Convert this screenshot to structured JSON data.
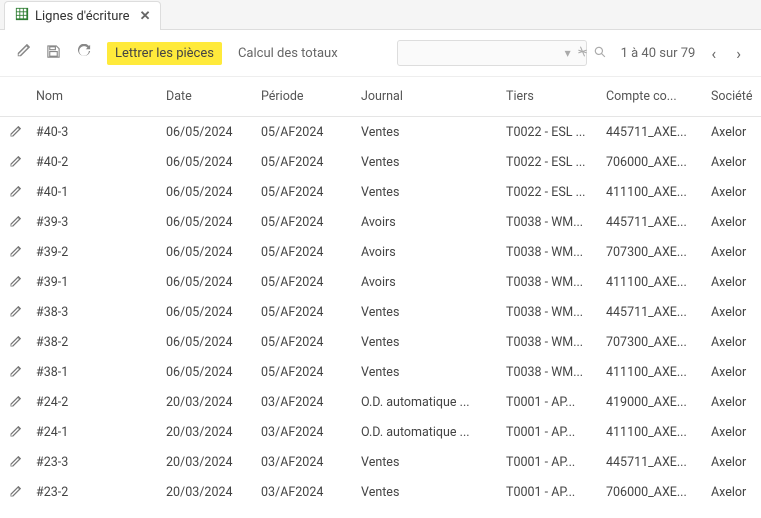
{
  "tab": {
    "title": "Lignes d'écriture"
  },
  "toolbar": {
    "lettrer": "Lettrer les pièces",
    "calcul": "Calcul des totaux"
  },
  "pager": {
    "text": "1 à 40 sur 79"
  },
  "columns": {
    "nom": "Nom",
    "date": "Date",
    "periode": "Période",
    "journal": "Journal",
    "tiers": "Tiers",
    "compte": "Compte co...",
    "societe": "Société"
  },
  "rows": [
    {
      "nom": "#40-3",
      "date": "06/05/2024",
      "periode": "05/AF2024",
      "journal": "Ventes",
      "tiers": "T0022 - ESL ...",
      "compte": "445711_AXE...",
      "societe": "Axelor"
    },
    {
      "nom": "#40-2",
      "date": "06/05/2024",
      "periode": "05/AF2024",
      "journal": "Ventes",
      "tiers": "T0022 - ESL ...",
      "compte": "706000_AXE...",
      "societe": "Axelor"
    },
    {
      "nom": "#40-1",
      "date": "06/05/2024",
      "periode": "05/AF2024",
      "journal": "Ventes",
      "tiers": "T0022 - ESL ...",
      "compte": "411100_AXE...",
      "societe": "Axelor"
    },
    {
      "nom": "#39-3",
      "date": "06/05/2024",
      "periode": "05/AF2024",
      "journal": "Avoirs",
      "tiers": "T0038 - WM...",
      "compte": "445711_AXE...",
      "societe": "Axelor"
    },
    {
      "nom": "#39-2",
      "date": "06/05/2024",
      "periode": "05/AF2024",
      "journal": "Avoirs",
      "tiers": "T0038 - WM...",
      "compte": "707300_AXE...",
      "societe": "Axelor"
    },
    {
      "nom": "#39-1",
      "date": "06/05/2024",
      "periode": "05/AF2024",
      "journal": "Avoirs",
      "tiers": "T0038 - WM...",
      "compte": "411100_AXE...",
      "societe": "Axelor"
    },
    {
      "nom": "#38-3",
      "date": "06/05/2024",
      "periode": "05/AF2024",
      "journal": "Ventes",
      "tiers": "T0038 - WM...",
      "compte": "445711_AXE...",
      "societe": "Axelor"
    },
    {
      "nom": "#38-2",
      "date": "06/05/2024",
      "periode": "05/AF2024",
      "journal": "Ventes",
      "tiers": "T0038 - WM...",
      "compte": "707300_AXE...",
      "societe": "Axelor"
    },
    {
      "nom": "#38-1",
      "date": "06/05/2024",
      "periode": "05/AF2024",
      "journal": "Ventes",
      "tiers": "T0038 - WM...",
      "compte": "411100_AXE...",
      "societe": "Axelor"
    },
    {
      "nom": "#24-2",
      "date": "20/03/2024",
      "periode": "03/AF2024",
      "journal": "O.D. automatique ...",
      "tiers": "T0001 - AP...",
      "compte": "419000_AXE...",
      "societe": "Axelor"
    },
    {
      "nom": "#24-1",
      "date": "20/03/2024",
      "periode": "03/AF2024",
      "journal": "O.D. automatique ...",
      "tiers": "T0001 - AP...",
      "compte": "411100_AXE...",
      "societe": "Axelor"
    },
    {
      "nom": "#23-3",
      "date": "20/03/2024",
      "periode": "03/AF2024",
      "journal": "Ventes",
      "tiers": "T0001 - AP...",
      "compte": "445711_AXE...",
      "societe": "Axelor"
    },
    {
      "nom": "#23-2",
      "date": "20/03/2024",
      "periode": "03/AF2024",
      "journal": "Ventes",
      "tiers": "T0001 - AP...",
      "compte": "706000_AXE...",
      "societe": "Axelor"
    }
  ]
}
